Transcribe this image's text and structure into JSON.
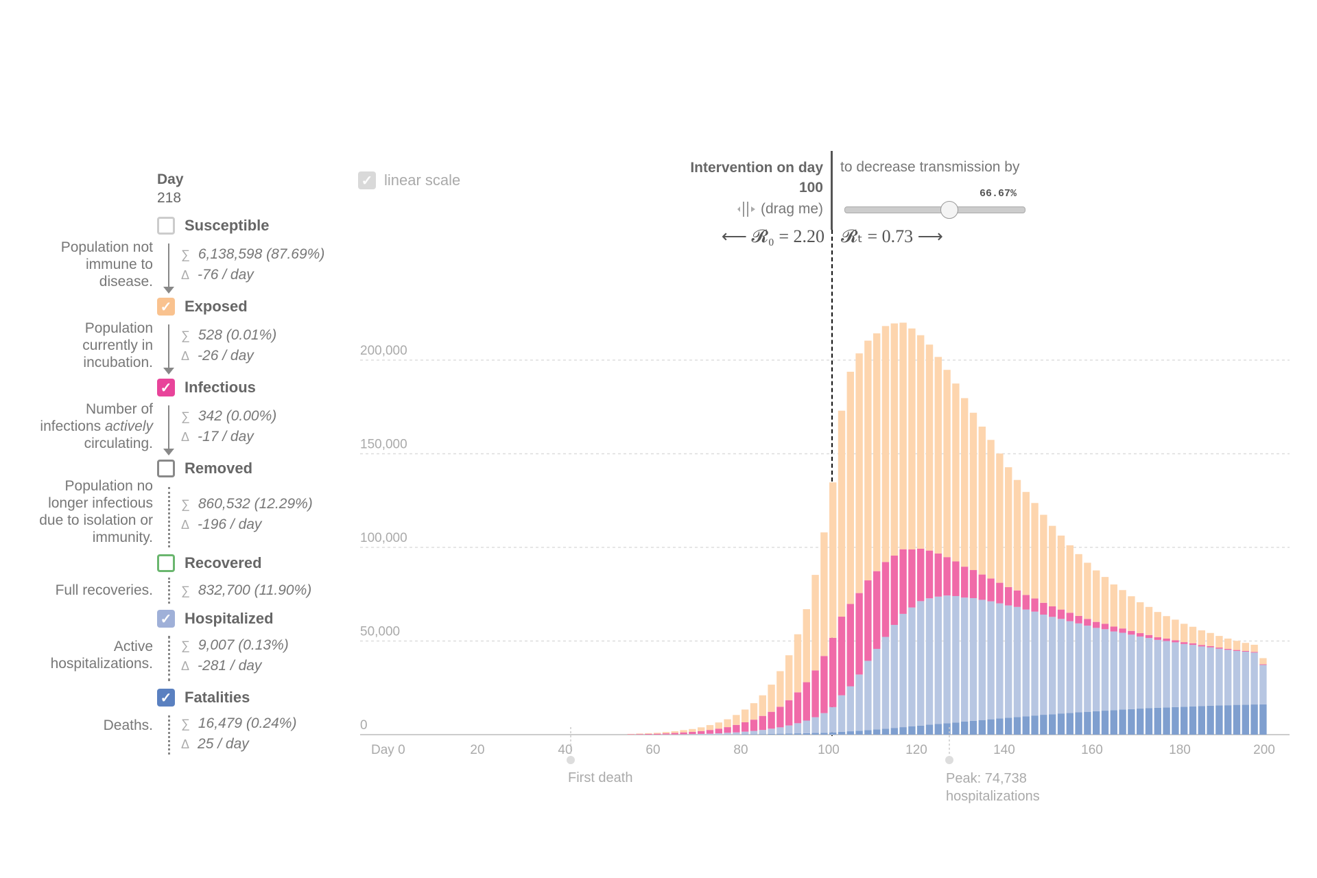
{
  "panel": {
    "day_label": "Day",
    "day_value": "218",
    "compartments": [
      {
        "name": "Susceptible",
        "checked": false,
        "color": "#cccccc",
        "desc": "Population not immune to disease.",
        "sum": "6,138,598 (87.69%)",
        "delta": "-76 / day"
      },
      {
        "name": "Exposed",
        "checked": true,
        "color": "#f9c28f",
        "desc": "Population currently in incubation.",
        "sum": "528 (0.01%)",
        "delta": "-26 / day"
      },
      {
        "name": "Infectious",
        "checked": true,
        "color": "#e8449a",
        "desc_parts": [
          "Number of infections ",
          "actively",
          " circulating."
        ],
        "sum": "342 (0.00%)",
        "delta": "-17 / day"
      },
      {
        "name": "Removed",
        "checked": false,
        "color": "#888888",
        "desc": "Population no longer infectious due to isolation or immunity.",
        "sum": "860,532 (12.29%)",
        "delta": "-196 / day"
      },
      {
        "name": "Recovered",
        "checked": false,
        "color": "#6ab66e",
        "desc": "Full recoveries.",
        "sum": "832,700 (11.90%)"
      },
      {
        "name": "Hospitalized",
        "checked": true,
        "color": "#9fb0d8",
        "desc": "Active hospitalizations.",
        "sum": "9,007 (0.13%)",
        "delta": "-281 / day"
      },
      {
        "name": "Fatalities",
        "checked": true,
        "color": "#5a80c0",
        "desc": "Deaths.",
        "sum": "16,479 (0.24%)",
        "delta": "25 / day"
      }
    ],
    "sum_symbol": "∑",
    "delta_symbol": "Δ",
    "check_glyph": "✓"
  },
  "controls": {
    "linear_scale_label": "linear scale",
    "linear_scale_checked": true,
    "intervention_title": "Intervention on day",
    "intervention_day": "100",
    "drag_hint": "(drag me)",
    "drag_icon": "drag-handle-icon",
    "decrease_text": "to decrease transmission by",
    "slider_value": "66.67%",
    "slider_fraction": 0.6667,
    "r0_text": "⟵ 𝓡₀ = 2.20",
    "rt_text": "𝓡ₜ = 0.73 ⟶"
  },
  "chart_data": {
    "type": "bar",
    "stacked": true,
    "xlabel": "",
    "ylabel": "",
    "x_ticks": [
      "Day 0",
      "20",
      "40",
      "60",
      "80",
      "100",
      "120",
      "140",
      "160",
      "180",
      "200"
    ],
    "x_tick_values": [
      0,
      20,
      40,
      60,
      80,
      100,
      120,
      140,
      160,
      180,
      200
    ],
    "y_ticks": [
      "0",
      "50,000",
      "100,000",
      "150,000",
      "200,000"
    ],
    "y_tick_values": [
      0,
      50000,
      100000,
      150000,
      200000
    ],
    "ylim": [
      0,
      245000
    ],
    "xlim": [
      0,
      204
    ],
    "grid": "horizontal-dashed",
    "intervention_day": 100,
    "annotations": [
      {
        "day": 41,
        "text": "First death"
      },
      {
        "day": 127,
        "text": "Peak: 74,738 hospitalizations"
      }
    ],
    "series_order": [
      "Fatalities",
      "Hospitalized",
      "Infectious",
      "Exposed"
    ],
    "colors": {
      "Fatalities": "#7f9fcf",
      "Hospitalized": "#b7c6e2",
      "Infectious": "#f06aa8",
      "Exposed": "#fdd5ae"
    },
    "days": [
      54,
      56,
      58,
      60,
      62,
      64,
      66,
      68,
      70,
      72,
      74,
      76,
      78,
      80,
      82,
      84,
      86,
      88,
      90,
      92,
      94,
      96,
      98,
      100,
      102,
      104,
      106,
      108,
      110,
      112,
      114,
      116,
      118,
      120,
      122,
      124,
      126,
      128,
      130,
      132,
      134,
      136,
      138,
      140,
      142,
      144,
      146,
      148,
      150,
      152,
      154,
      156,
      158,
      160,
      162,
      164,
      166,
      168,
      170,
      172,
      174,
      176,
      178,
      180,
      182,
      184,
      186,
      188,
      190,
      192,
      194,
      196,
      198
    ],
    "series": [
      {
        "name": "Fatalities",
        "values": [
          0,
          0,
          0,
          0,
          0,
          0,
          0,
          0,
          0,
          0,
          0,
          100,
          100,
          200,
          200,
          300,
          400,
          500,
          600,
          700,
          800,
          900,
          1000,
          1200,
          1500,
          1800,
          2100,
          2400,
          2800,
          3200,
          3600,
          4000,
          4400,
          4800,
          5300,
          5700,
          6100,
          6500,
          7000,
          7400,
          7800,
          8200,
          8600,
          9000,
          9400,
          9800,
          10200,
          10600,
          10900,
          11300,
          11600,
          11900,
          12200,
          12500,
          12800,
          13100,
          13400,
          13600,
          13900,
          14100,
          14300,
          14500,
          14700,
          14900,
          15100,
          15300,
          15400,
          15600,
          15700,
          15900,
          16000,
          16100,
          16200
        ]
      },
      {
        "name": "Hospitalized",
        "values": [
          0,
          0,
          0,
          0,
          100,
          100,
          200,
          300,
          400,
          500,
          700,
          900,
          1100,
          1400,
          1800,
          2200,
          2800,
          3400,
          4300,
          5400,
          6700,
          8400,
          10500,
          13500,
          19500,
          24000,
          30000,
          37000,
          43000,
          49000,
          55000,
          60500,
          63500,
          66500,
          67500,
          68000,
          68200,
          67500,
          66200,
          65500,
          64200,
          63000,
          61500,
          60000,
          58800,
          57000,
          55500,
          53500,
          52000,
          50500,
          49000,
          47500,
          46000,
          44500,
          43500,
          42000,
          41000,
          39800,
          38500,
          37500,
          36300,
          35500,
          34600,
          33500,
          32800,
          31800,
          31200,
          30300,
          29600,
          28800,
          28300,
          27700,
          21000
        ]
      },
      {
        "name": "Infectious",
        "values": [
          200,
          300,
          400,
          500,
          600,
          800,
          1000,
          1200,
          1500,
          2000,
          2500,
          3000,
          4000,
          5000,
          6000,
          7500,
          9000,
          11000,
          13500,
          16500,
          20500,
          25000,
          30500,
          37000,
          42000,
          44000,
          43500,
          43000,
          41500,
          40000,
          37000,
          34500,
          31000,
          28000,
          25500,
          23000,
          20500,
          18500,
          16500,
          15000,
          13500,
          12200,
          11000,
          9800,
          8800,
          7800,
          7000,
          6300,
          5600,
          5000,
          4500,
          4000,
          3600,
          3200,
          2900,
          2600,
          2300,
          2000,
          1800,
          1600,
          1400,
          1300,
          1100,
          1000,
          900,
          800,
          700,
          600,
          500,
          500,
          400,
          400,
          350
        ]
      },
      {
        "name": "Exposed",
        "values": [
          200,
          300,
          400,
          500,
          700,
          900,
          1200,
          1500,
          2000,
          2600,
          3300,
          4200,
          5300,
          6800,
          8800,
          11000,
          14500,
          19000,
          24000,
          31000,
          39000,
          51000,
          66000,
          83000,
          110000,
          124000,
          128000,
          128000,
          127000,
          126000,
          124000,
          121000,
          118000,
          114000,
          110000,
          105000,
          100000,
          95000,
          90000,
          84000,
          79000,
          74000,
          69000,
          64000,
          59000,
          55000,
          51000,
          47000,
          43000,
          39500,
          36000,
          33000,
          30000,
          27500,
          25000,
          22500,
          20500,
          18500,
          16500,
          15000,
          13500,
          12000,
          11000,
          9800,
          8800,
          7800,
          7000,
          6200,
          5500,
          4900,
          4300,
          3800,
          3300
        ]
      }
    ]
  }
}
